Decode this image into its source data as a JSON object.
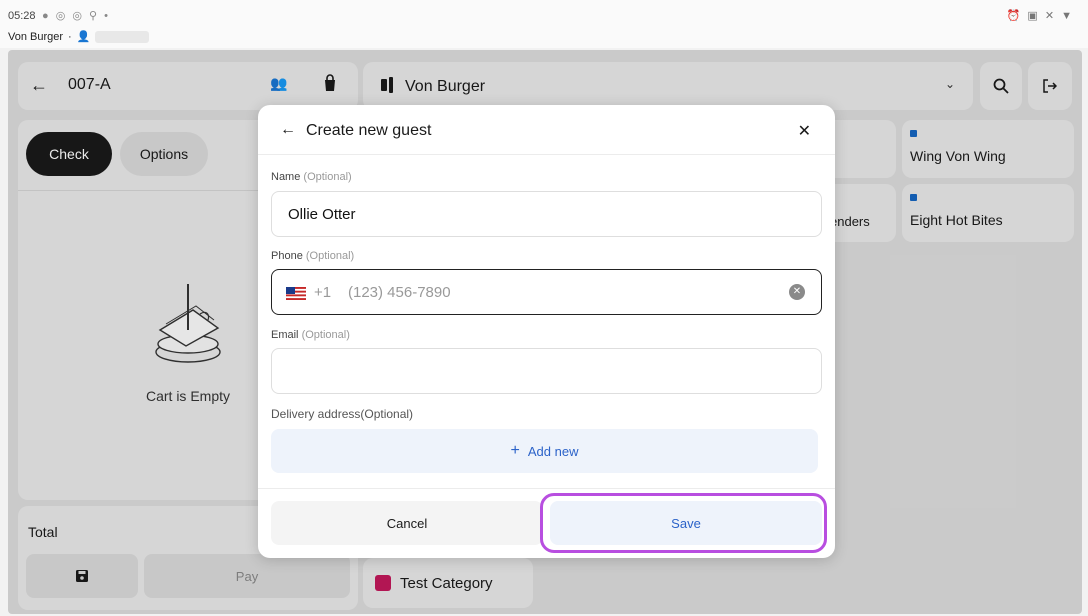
{
  "status_bar": {
    "time": "05:28",
    "store": "Von Burger",
    "separator": "·"
  },
  "header": {
    "table_id": "007-A",
    "store_name": "Von Burger"
  },
  "tabs": {
    "check": "Check",
    "options": "Options"
  },
  "cart": {
    "empty_text": "Cart is Empty",
    "total_label": "Total",
    "pay_label": "Pay"
  },
  "menu": {
    "items": [
      {
        "label": "Wing Von Wing"
      },
      {
        "label": "Eight Hot Bites"
      }
    ],
    "partial_item": "enders",
    "category": "Test Category"
  },
  "modal": {
    "title": "Create new guest",
    "optional_suffix": "(Optional)",
    "name": {
      "label": "Name",
      "value": "Ollie Otter"
    },
    "phone": {
      "label": "Phone",
      "prefix": "+1",
      "placeholder": "(123) 456-7890"
    },
    "email": {
      "label": "Email",
      "value": ""
    },
    "delivery_label": "Delivery address(Optional)",
    "add_new_label": "Add new",
    "cancel_label": "Cancel",
    "save_label": "Save"
  },
  "colors": {
    "accent_blue": "#2c63c9",
    "highlight_purple": "#b84ee0",
    "category_pink": "#c2185b",
    "menu_dot_blue": "#1565c0"
  }
}
